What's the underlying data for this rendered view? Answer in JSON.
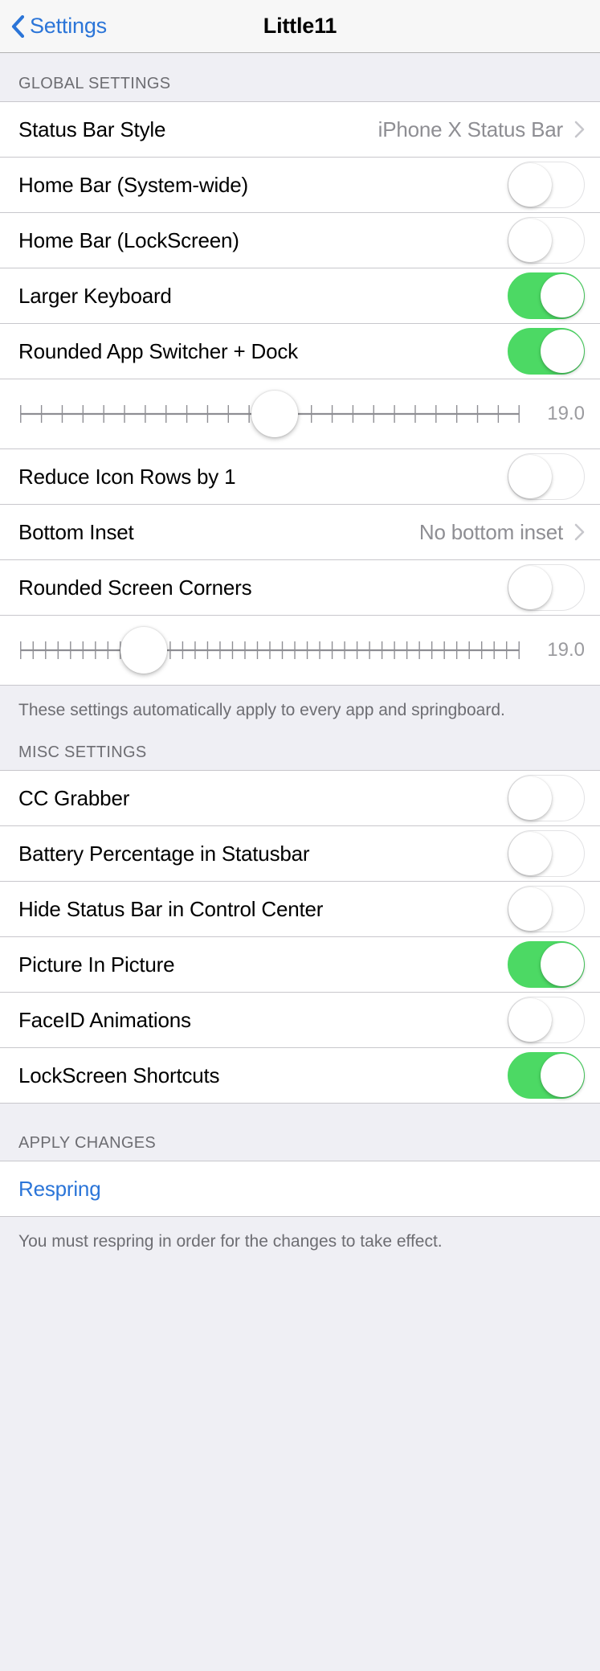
{
  "nav": {
    "back_label": "Settings",
    "title": "Little11",
    "back_icon": "chevron-left-icon",
    "tint_color": "#2b75d8"
  },
  "colors": {
    "switch_on": "#4cd964",
    "separator": "#c8c7cc",
    "group_background": "#efeff4",
    "secondary_text": "#8e8e93"
  },
  "sections": [
    {
      "header": "GLOBAL SETTINGS",
      "footer": "These settings automatically apply to every app and springboard.",
      "rows": [
        {
          "type": "disclosure",
          "label": "Status Bar Style",
          "value": "iPhone X Status Bar",
          "accessory": "chevron-right-icon"
        },
        {
          "type": "switch",
          "label": "Home Bar (System-wide)",
          "value": "off"
        },
        {
          "type": "switch",
          "label": "Home Bar (LockScreen)",
          "value": "off"
        },
        {
          "type": "switch",
          "label": "Larger Keyboard",
          "value": "on"
        },
        {
          "type": "switch",
          "label": "Rounded App Switcher + Dock",
          "value": "on"
        },
        {
          "type": "slider",
          "label": "",
          "value": "19.0",
          "percent": 51,
          "ticks": 25
        },
        {
          "type": "switch",
          "label": "Reduce Icon Rows by 1",
          "value": "off"
        },
        {
          "type": "disclosure",
          "label": "Bottom Inset",
          "value": "No bottom inset",
          "accessory": "chevron-right-icon"
        },
        {
          "type": "switch",
          "label": "Rounded Screen Corners",
          "value": "off"
        },
        {
          "type": "slider",
          "label": "",
          "value": "19.0",
          "percent": 25,
          "ticks": 41
        }
      ]
    },
    {
      "header": "MISC SETTINGS",
      "footer": "",
      "rows": [
        {
          "type": "switch",
          "label": "CC Grabber",
          "value": "off"
        },
        {
          "type": "switch",
          "label": "Battery Percentage in Statusbar",
          "value": "off"
        },
        {
          "type": "switch",
          "label": "Hide Status Bar in Control Center",
          "value": "off"
        },
        {
          "type": "switch",
          "label": "Picture In Picture",
          "value": "on"
        },
        {
          "type": "switch",
          "label": "FaceID Animations",
          "value": "off"
        },
        {
          "type": "switch",
          "label": "LockScreen Shortcuts",
          "value": "on"
        }
      ]
    },
    {
      "header": "APPLY CHANGES",
      "footer": "You must respring in order for the changes to take effect.",
      "rows": [
        {
          "type": "action",
          "label": "Respring",
          "value": ""
        }
      ]
    }
  ]
}
